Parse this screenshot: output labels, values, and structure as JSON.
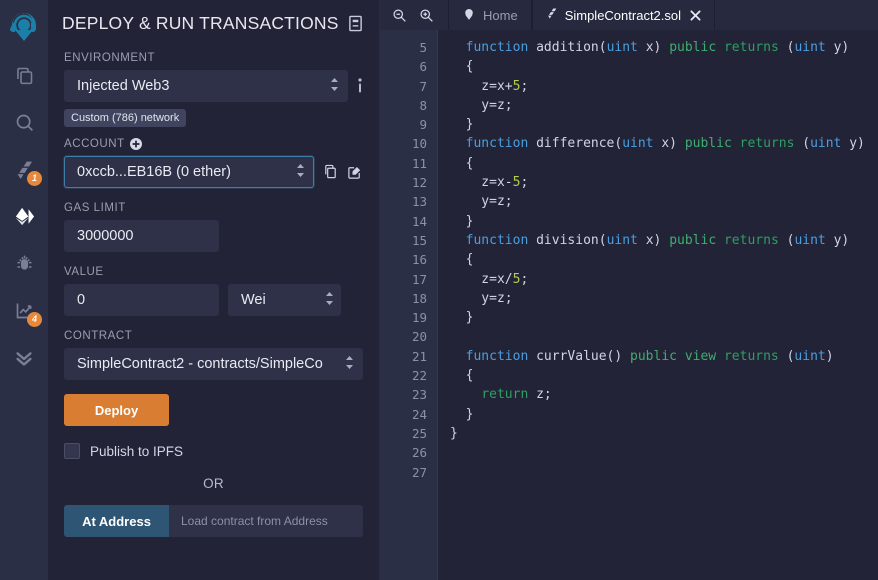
{
  "rail": {
    "logo": "remix-logo",
    "items": [
      {
        "name": "file-explorers",
        "icon": "files-icon",
        "badge": null,
        "active": false
      },
      {
        "name": "search",
        "icon": "search-icon",
        "badge": null,
        "active": false
      },
      {
        "name": "solidity-compiler",
        "icon": "solidity-icon",
        "badge": "1",
        "active": false
      },
      {
        "name": "deploy-and-run",
        "icon": "ethereum-icon",
        "badge": null,
        "active": true
      },
      {
        "name": "debugger",
        "icon": "bug-icon",
        "badge": null,
        "active": false
      },
      {
        "name": "solidity-analysis",
        "icon": "chart-icon",
        "badge": "4",
        "active": false
      },
      {
        "name": "plugin-manager",
        "icon": "double-chevron-down-icon",
        "badge": null,
        "active": false
      }
    ]
  },
  "panel": {
    "title": "DEPLOY & RUN TRANSACTIONS",
    "doc_icon": "book-icon",
    "environment": {
      "label": "ENVIRONMENT",
      "value": "Injected Web3",
      "info_icon": "info-icon",
      "network_badge": "Custom (786) network"
    },
    "account": {
      "label": "ACCOUNT",
      "add_icon": "plus-circle-icon",
      "value": "0xccb...EB16B (0 ether)",
      "copy_icon": "copy-icon",
      "edit_icon": "sign-message-icon"
    },
    "gas_limit": {
      "label": "GAS LIMIT",
      "value": "3000000"
    },
    "value": {
      "label": "VALUE",
      "amount": "0",
      "unit": "Wei"
    },
    "contract": {
      "label": "CONTRACT",
      "value": "SimpleContract2 - contracts/SimpleCo"
    },
    "deploy_button": "Deploy",
    "publish_ipfs_label": "Publish to IPFS",
    "or_text": "OR",
    "at_address_button": "At Address",
    "at_address_placeholder": "Load contract from Address"
  },
  "editor": {
    "zoom_out_icon": "zoom-out-icon",
    "zoom_in_icon": "zoom-in-icon",
    "tabs": [
      {
        "label": "Home",
        "icon": "remix-home-icon",
        "active": false,
        "closable": false
      },
      {
        "label": "SimpleContract2.sol",
        "icon": "solidity-file-icon",
        "active": true,
        "closable": true,
        "close_icon": "close-icon"
      }
    ],
    "first_line_number": 5,
    "last_line_number": 27,
    "lines": [
      {
        "n": 5,
        "tokens": [
          [
            "kw",
            "function "
          ],
          [
            "fn",
            "addition("
          ],
          [
            "kw",
            "uint"
          ],
          [
            "plain",
            " x) "
          ],
          [
            "mod",
            "public "
          ],
          [
            "ret",
            "returns "
          ],
          [
            "plain",
            "("
          ],
          [
            "kw",
            "uint"
          ],
          [
            "plain",
            " y)"
          ]
        ]
      },
      {
        "n": 6,
        "tokens": [
          [
            "plain",
            "{"
          ]
        ]
      },
      {
        "n": 7,
        "tokens": [
          [
            "plain",
            "  z=x+"
          ],
          [
            "num",
            "5"
          ],
          [
            "plain",
            ";"
          ]
        ]
      },
      {
        "n": 8,
        "tokens": [
          [
            "plain",
            "  y=z;"
          ]
        ]
      },
      {
        "n": 9,
        "tokens": [
          [
            "plain",
            "}"
          ]
        ]
      },
      {
        "n": 10,
        "tokens": [
          [
            "kw",
            "function "
          ],
          [
            "fn",
            "difference("
          ],
          [
            "kw",
            "uint"
          ],
          [
            "plain",
            " x) "
          ],
          [
            "mod",
            "public "
          ],
          [
            "ret",
            "returns "
          ],
          [
            "plain",
            "("
          ],
          [
            "kw",
            "uint"
          ],
          [
            "plain",
            " y)"
          ]
        ]
      },
      {
        "n": 11,
        "tokens": [
          [
            "plain",
            "{"
          ]
        ]
      },
      {
        "n": 12,
        "tokens": [
          [
            "plain",
            "  z=x-"
          ],
          [
            "num",
            "5"
          ],
          [
            "plain",
            ";"
          ]
        ]
      },
      {
        "n": 13,
        "tokens": [
          [
            "plain",
            "  y=z;"
          ]
        ]
      },
      {
        "n": 14,
        "tokens": [
          [
            "plain",
            "}"
          ]
        ]
      },
      {
        "n": 15,
        "tokens": [
          [
            "kw",
            "function "
          ],
          [
            "fn",
            "division("
          ],
          [
            "kw",
            "uint"
          ],
          [
            "plain",
            " x) "
          ],
          [
            "mod",
            "public "
          ],
          [
            "ret",
            "returns "
          ],
          [
            "plain",
            "("
          ],
          [
            "kw",
            "uint"
          ],
          [
            "plain",
            " y)"
          ]
        ]
      },
      {
        "n": 16,
        "tokens": [
          [
            "plain",
            "{"
          ]
        ]
      },
      {
        "n": 17,
        "tokens": [
          [
            "plain",
            "  z=x/"
          ],
          [
            "num",
            "5"
          ],
          [
            "plain",
            ";"
          ]
        ]
      },
      {
        "n": 18,
        "tokens": [
          [
            "plain",
            "  y=z;"
          ]
        ]
      },
      {
        "n": 19,
        "tokens": [
          [
            "plain",
            "}"
          ]
        ]
      },
      {
        "n": 20,
        "tokens": [
          [
            "plain",
            ""
          ]
        ]
      },
      {
        "n": 21,
        "tokens": [
          [
            "kw",
            "function "
          ],
          [
            "fn",
            "currValue() "
          ],
          [
            "mod",
            "public "
          ],
          [
            "mod",
            "view "
          ],
          [
            "ret",
            "returns "
          ],
          [
            "plain",
            "("
          ],
          [
            "kw",
            "uint"
          ],
          [
            "plain",
            ")"
          ]
        ]
      },
      {
        "n": 22,
        "tokens": [
          [
            "plain",
            "{"
          ]
        ]
      },
      {
        "n": 23,
        "tokens": [
          [
            "plain",
            "  "
          ],
          [
            "ret",
            "return"
          ],
          [
            "plain",
            " z;"
          ]
        ]
      },
      {
        "n": 24,
        "tokens": [
          [
            "plain",
            "}"
          ]
        ]
      },
      {
        "n": 25,
        "tokens": [
          [
            "plain",
            ""
          ]
        ]
      },
      {
        "n": 26,
        "tokens": [
          [
            "plain",
            ""
          ]
        ]
      },
      {
        "n": 27,
        "tokens": [
          [
            "plain",
            ""
          ]
        ]
      }
    ],
    "indent_prefix": "  ",
    "close_brace_line": 25,
    "close_brace": "}"
  },
  "colors": {
    "accent_orange": "#d97d32",
    "accent_blue": "#2e5574",
    "panel_bg": "#222336",
    "rail_bg": "#2a2f45",
    "badge_orange": "#e8883a"
  }
}
